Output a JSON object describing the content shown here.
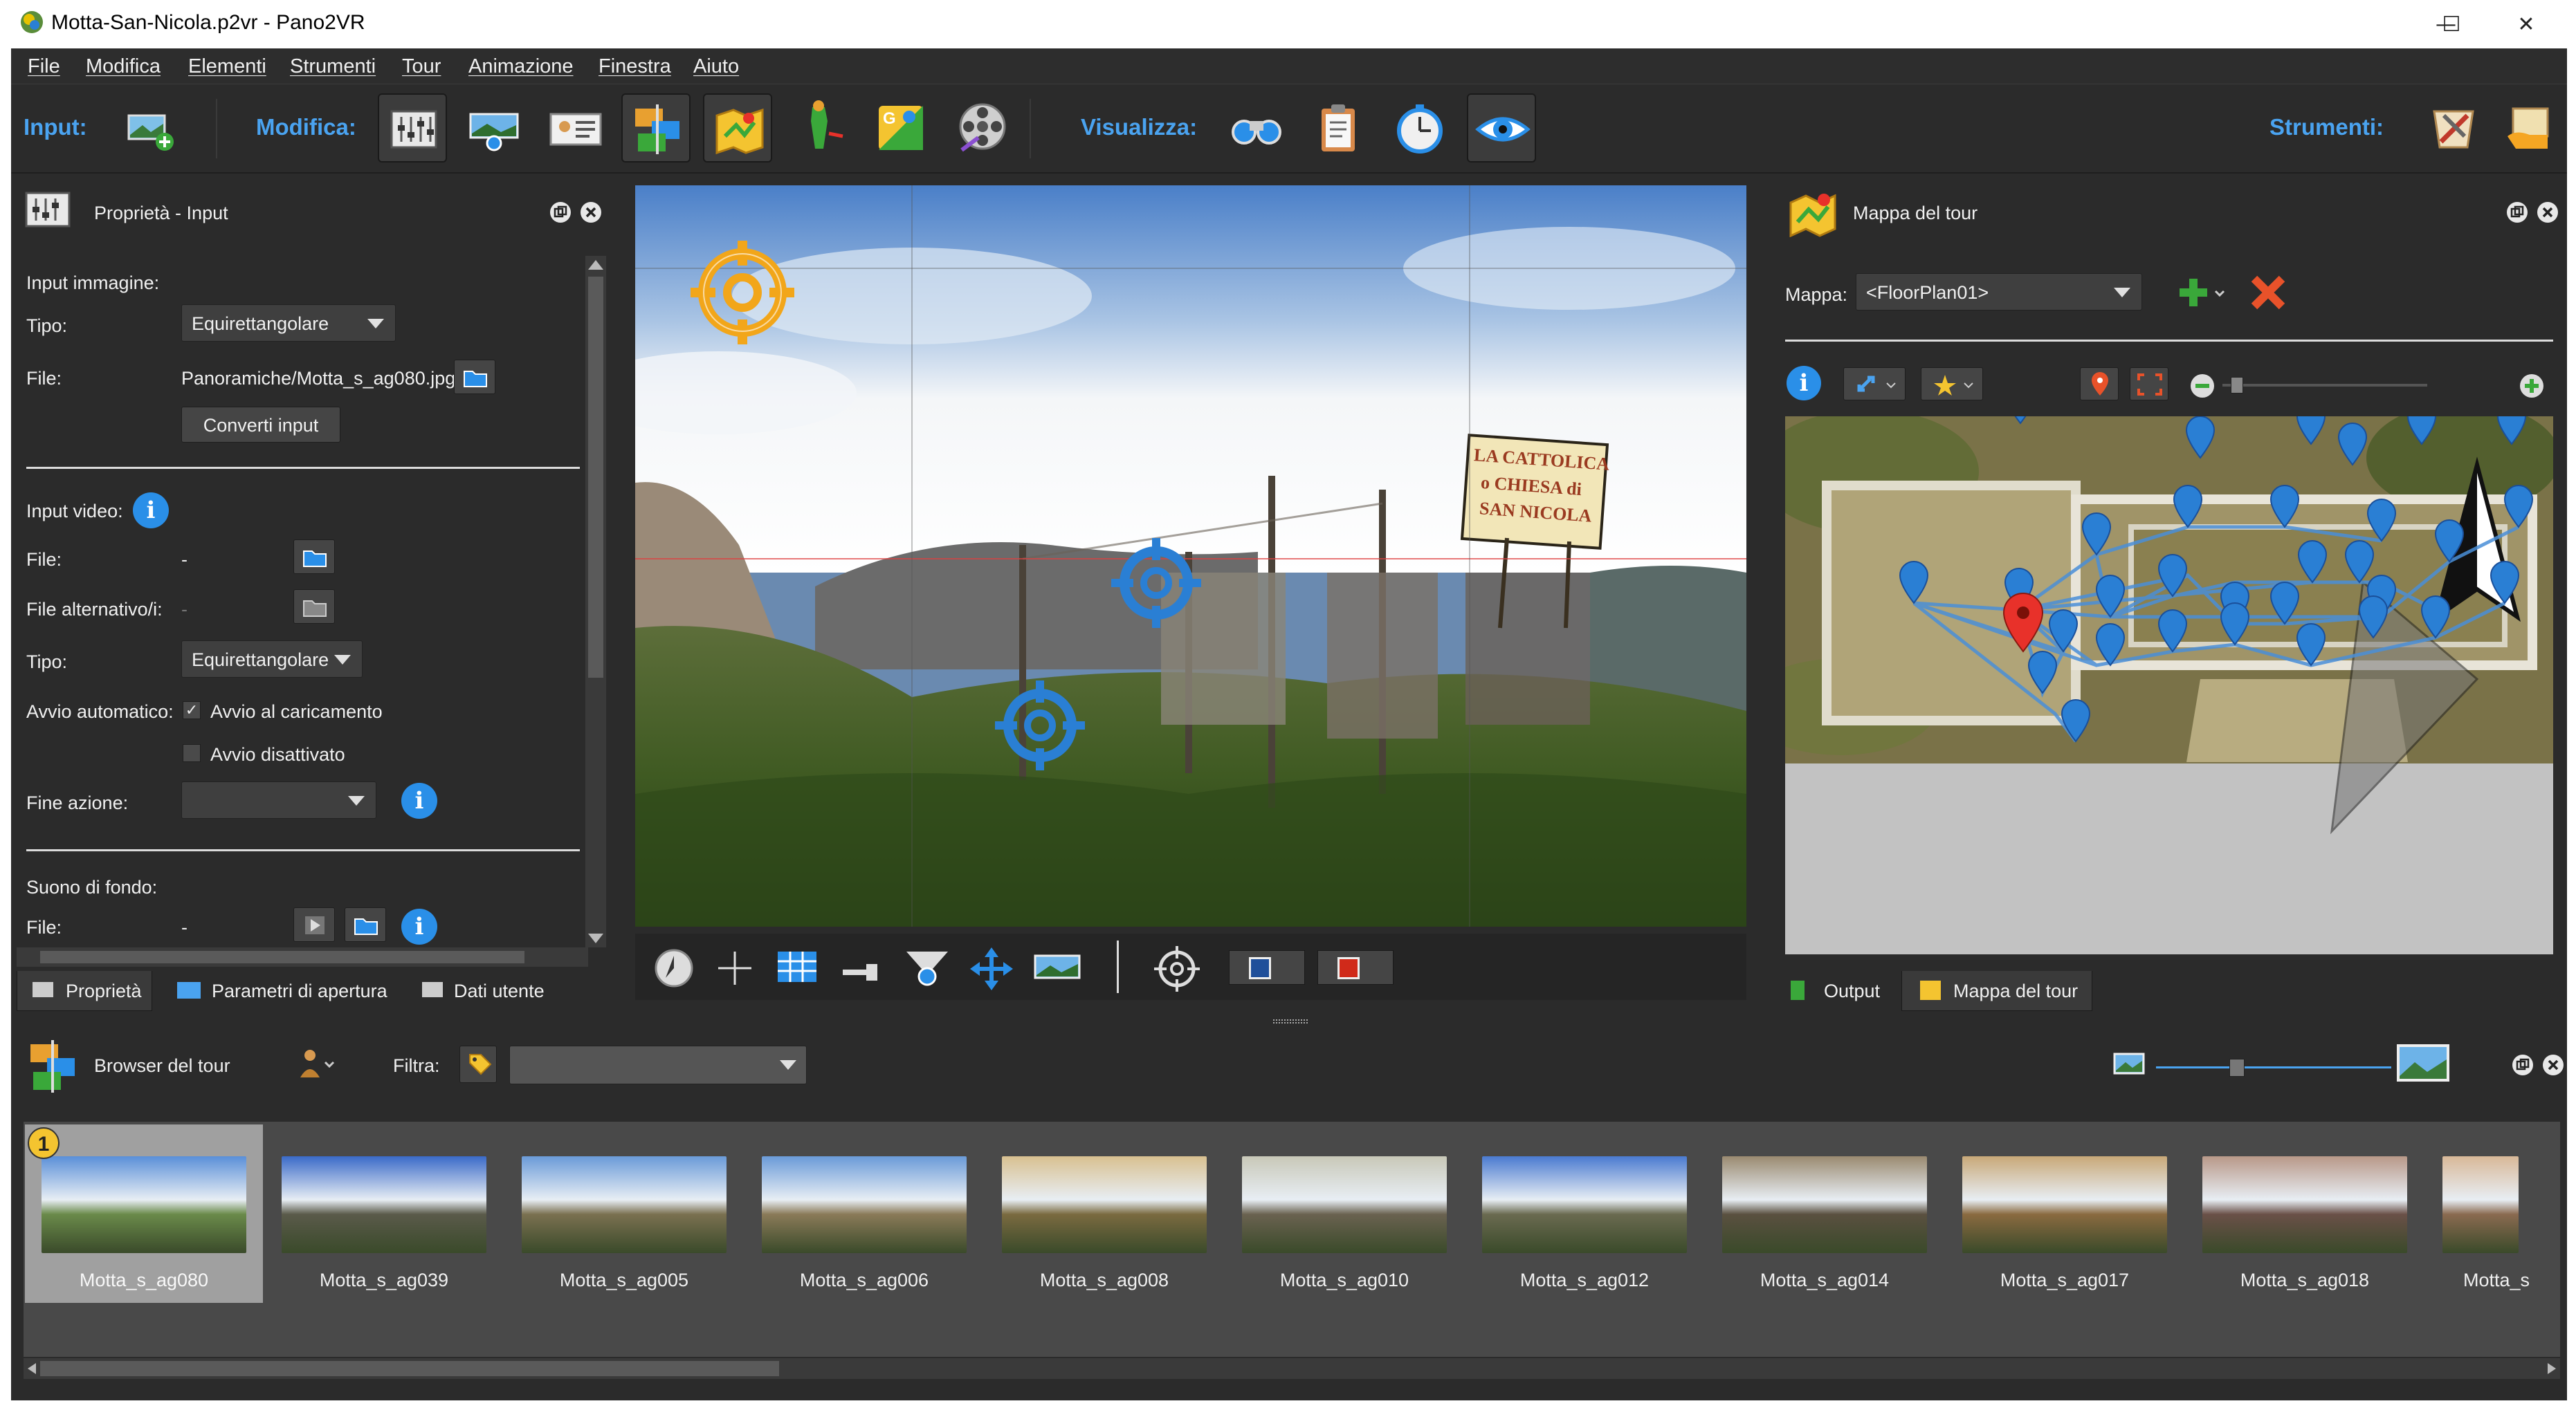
{
  "window": {
    "title": "Motta-San-Nicola.p2vr - Pano2VR",
    "controls": {
      "minimize": "—",
      "maximize": "☐",
      "close": "✕"
    }
  },
  "menu": [
    "File",
    "Modifica",
    "Elementi",
    "Strumenti",
    "Tour",
    "Animazione",
    "Finestra",
    "Aiuto"
  ],
  "toolbar": {
    "input_label": "Input:",
    "modifica_label": "Modifica:",
    "visualizza_label": "Visualizza:",
    "strumenti_label": "Strumenti:"
  },
  "properties_panel": {
    "title": "Proprietà - Input",
    "input_immagine_label": "Input immagine:",
    "tipo_label": "Tipo:",
    "tipo_value": "Equirettangolare",
    "file_label": "File:",
    "file_value": "Panoramiche/Motta_s_ag080.jpg",
    "convert_button": "Converti input",
    "input_video_label": "Input video:",
    "video_file_label": "File:",
    "video_file_value": "-",
    "alt_file_label": "File alternativo/i:",
    "alt_file_value": "-",
    "video_tipo_label": "Tipo:",
    "video_tipo_value": "Equirettangolare",
    "autostart_label": "Avvio automatico:",
    "autostart_on": "Avvio al caricamento",
    "autostart_off": "Avvio disattivato",
    "end_action_label": "Fine azione:",
    "background_sound_label": "Suono di fondo:",
    "sound_file_label": "File:",
    "sound_file_value": "-",
    "tabs": [
      "Proprietà",
      "Parametri di apertura",
      "Dati utente"
    ]
  },
  "viewer": {
    "sign_text_1": "LA CATTOLICA",
    "sign_text_2": "o CHIESA di",
    "sign_text_3": "SAN NICOLA"
  },
  "tour_map": {
    "title": "Mappa del tour",
    "map_label": "Mappa:",
    "map_value": "<FloorPlan01>",
    "tabs": [
      "Output",
      "Mappa del tour"
    ]
  },
  "browser": {
    "title": "Browser del tour",
    "filter_label": "Filtra:",
    "filter_value": "",
    "badge": "1",
    "items": [
      "Motta_s_ag080",
      "Motta_s_ag039",
      "Motta_s_ag005",
      "Motta_s_ag006",
      "Motta_s_ag008",
      "Motta_s_ag010",
      "Motta_s_ag012",
      "Motta_s_ag014",
      "Motta_s_ag017",
      "Motta_s_ag018",
      "Motta_s"
    ]
  },
  "colors": {
    "accent": "#4aa3f0",
    "panel": "#2b2b2b",
    "selection": "#a0a0a0",
    "hotspot": "#2a7fd4",
    "pin_active": "#e8312a",
    "info": "#2a8fe8"
  }
}
